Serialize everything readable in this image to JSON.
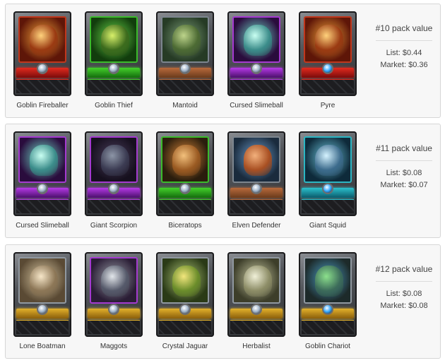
{
  "packs": [
    {
      "title": "#10 pack value",
      "list_price": "List: $0.44",
      "market_price": "Market: $0.36",
      "cards": [
        {
          "name": "Goblin Fireballer",
          "theme": "fire"
        },
        {
          "name": "Goblin Thief",
          "theme": "earth"
        },
        {
          "name": "Mantoid",
          "theme": "neutral"
        },
        {
          "name": "Cursed Slimeball",
          "theme": "death"
        },
        {
          "name": "Pyre",
          "theme": "fireb"
        }
      ]
    },
    {
      "title": "#11 pack value",
      "list_price": "List: $0.08",
      "market_price": "Market: $0.07",
      "cards": [
        {
          "name": "Cursed Slimeball",
          "theme": "death"
        },
        {
          "name": "Giant Scorpion",
          "theme": "deathb"
        },
        {
          "name": "Biceratops",
          "theme": "earthb"
        },
        {
          "name": "Elven Defender",
          "theme": "elven"
        },
        {
          "name": "Giant Squid",
          "theme": "water"
        }
      ]
    },
    {
      "title": "#12 pack value",
      "list_price": "List: $0.08",
      "market_price": "Market: $0.08",
      "cards": [
        {
          "name": "Lone Boatman",
          "theme": "gold"
        },
        {
          "name": "Maggots",
          "theme": "goldm"
        },
        {
          "name": "Crystal Jaguar",
          "theme": "goldj"
        },
        {
          "name": "Herbalist",
          "theme": "goldh"
        },
        {
          "name": "Goblin Chariot",
          "theme": "goldg"
        }
      ]
    }
  ]
}
